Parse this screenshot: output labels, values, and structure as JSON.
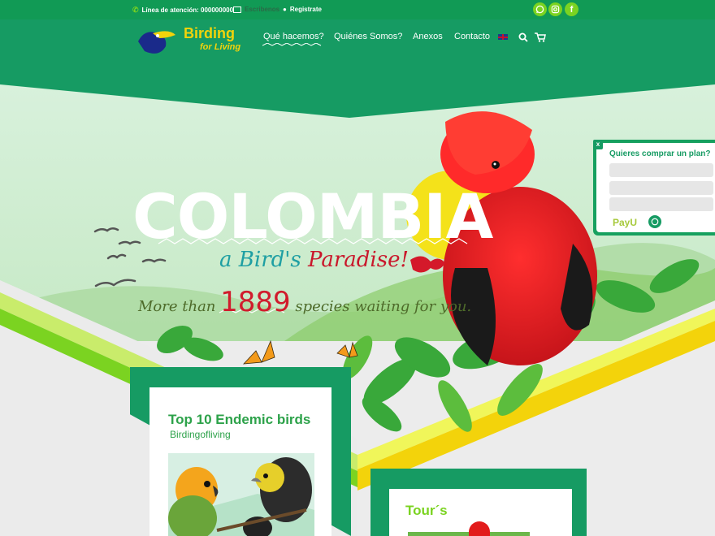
{
  "topbar": {
    "hotline": "Línea de atención: 000000000",
    "email_label": "Escribenos",
    "register": "Registrate"
  },
  "brand": {
    "line1": "Birding",
    "line2": "for Living"
  },
  "nav": [
    {
      "label": "Qué hacemos?"
    },
    {
      "label": "Quiénes Somos?"
    },
    {
      "label": "Anexos"
    },
    {
      "label": "Contacto"
    }
  ],
  "hero": {
    "title": "COLOMBIA",
    "subtitle_a": "a Bird's",
    "subtitle_b": "Paradise!",
    "tagline_pre": "More than",
    "tagline_number": "1889",
    "tagline_post": "species waiting for you."
  },
  "cards": [
    {
      "title": "Top 10 Endemic birds",
      "subtitle": "Birdingofliving"
    },
    {
      "title": "Tour´s"
    }
  ],
  "purchase_panel": {
    "close": "x",
    "title": "Quieres comprar un plan?",
    "payment": "PayU"
  },
  "colors": {
    "brand_green": "#169b63",
    "lime": "#7bd321",
    "brand_yellow": "#f3d30b"
  }
}
